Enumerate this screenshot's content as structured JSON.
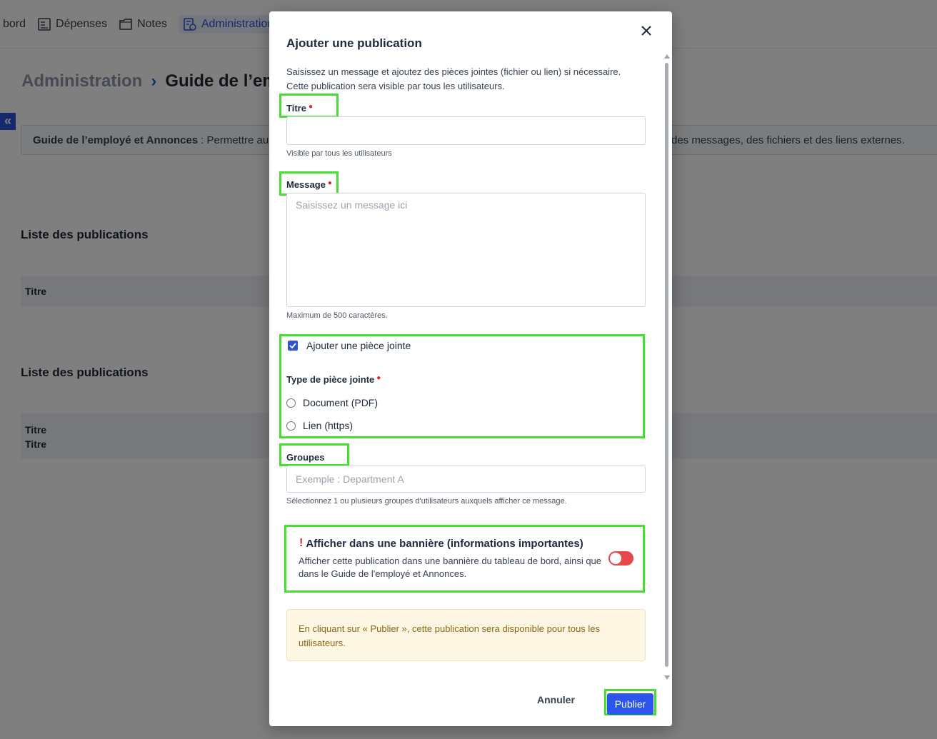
{
  "topnav": {
    "items": [
      {
        "label": "bord",
        "icon": "dashboard-icon",
        "active": false
      },
      {
        "label": "Dépenses",
        "icon": "receipt-icon",
        "active": false
      },
      {
        "label": "Notes",
        "icon": "folder-icon",
        "active": false
      },
      {
        "label": "Administration",
        "icon": "admin-document-icon",
        "active": true
      }
    ]
  },
  "breadcrumb": {
    "root": "Administration",
    "separator": "›",
    "current": "Guide de l’emp"
  },
  "collapse_button": "«",
  "info_box": {
    "bold": "Guide de l’employé et Annonces",
    "text": ": Permettre au",
    "text_right": "des messages, des fichiers et des liens externes."
  },
  "sections": [
    {
      "title": "Liste des publications",
      "columns": [
        "Titre"
      ]
    },
    {
      "title": "Liste des publications",
      "columns": [
        "Titre",
        "Titre"
      ]
    }
  ],
  "modal": {
    "title": "Ajouter une publication",
    "intro_line1": "Saisissez un message et ajoutez des pièces jointes (fichier ou lien) si nécessaire.",
    "intro_line2": "Cette publication sera visible par tous les utilisateurs.",
    "title_field": {
      "label": "Titre",
      "value": "",
      "placeholder": "",
      "help": "Visible par tous les utilisateurs"
    },
    "message_field": {
      "label": "Message",
      "value": "",
      "placeholder": "Saisissez un message ici",
      "help": "Maximum de 500 caractères."
    },
    "attachment": {
      "checkbox_label": "Ajouter une pièce jointe",
      "checked": true,
      "type_label": "Type de pièce jointe",
      "options": [
        "Document (PDF)",
        "Lien (https)"
      ]
    },
    "groups_field": {
      "label": "Groupes",
      "value": "",
      "placeholder": "Exemple : Department A",
      "help": "Sélectionnez 1 ou plusieurs groupes d'utilisateurs auxquels afficher ce message."
    },
    "banner": {
      "title": "Afficher dans une bannière (informations importantes)",
      "description": "Afficher cette publication dans une bannière du tableau de bord, ainsi que dans le Guide de l'employé et Annonces.",
      "toggle_on": false
    },
    "notice": "En cliquant sur « Publier », cette publication sera disponible pour tous les utilisateurs.",
    "cancel_label": "Annuler",
    "publish_label": "Publier"
  },
  "colors": {
    "accent": "#2b55ee",
    "highlight": "#44e02f",
    "required": "#dc2626",
    "toggle_off": "#e5484d",
    "notice_bg": "#fdf7e3",
    "notice_text": "#8a6516"
  }
}
